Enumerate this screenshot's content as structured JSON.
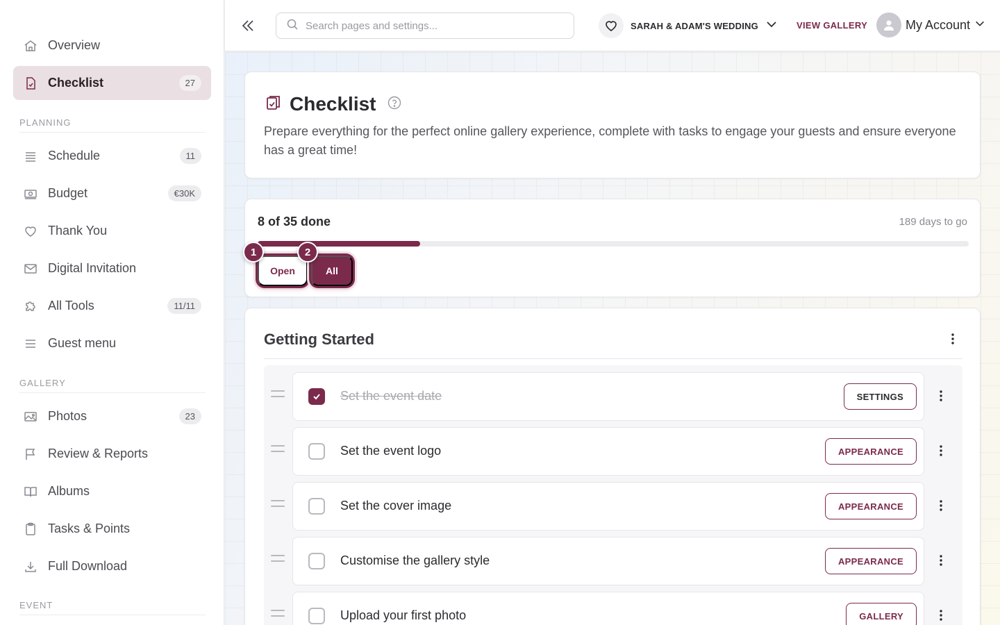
{
  "sidebar": {
    "items_top": [
      {
        "label": "Overview",
        "icon": "home-icon",
        "badge": ""
      },
      {
        "label": "Checklist",
        "icon": "checklist-icon",
        "badge": "27",
        "active": true
      }
    ],
    "planning_head": "PLANNING",
    "planning_items": [
      {
        "label": "Schedule",
        "icon": "schedule-icon",
        "badge": "11"
      },
      {
        "label": "Budget",
        "icon": "money-icon",
        "badge": "€30K"
      },
      {
        "label": "Thank You",
        "icon": "heart-icon",
        "badge": ""
      },
      {
        "label": "Digital Invitation",
        "icon": "envelope-icon",
        "badge": ""
      },
      {
        "label": "All Tools",
        "icon": "puzzle-icon",
        "badge": "11/11"
      },
      {
        "label": "Guest menu",
        "icon": "menu-icon",
        "badge": ""
      }
    ],
    "gallery_head": "GALLERY",
    "gallery_items": [
      {
        "label": "Photos",
        "icon": "image-icon",
        "badge": "23"
      },
      {
        "label": "Review & Reports",
        "icon": "flag-icon",
        "badge": ""
      },
      {
        "label": "Albums",
        "icon": "book-icon",
        "badge": ""
      },
      {
        "label": "Tasks & Points",
        "icon": "clipboard-icon",
        "badge": ""
      },
      {
        "label": "Full Download",
        "icon": "download-icon",
        "badge": ""
      }
    ],
    "event_head": "EVENT"
  },
  "topbar": {
    "search_placeholder": "Search pages and settings...",
    "event_name": "SARAH & ADAM'S WEDDING",
    "view_gallery": "VIEW GALLERY",
    "account_label": "My Account"
  },
  "header": {
    "title": "Checklist",
    "description": "Prepare everything for the perfect online gallery experience, complete with tasks to engage your guests and ensure everyone has a great time!"
  },
  "progress": {
    "done_label": "8 of 35 done",
    "days_label": "189 days to go",
    "fraction": 0.229,
    "filter_open": "Open",
    "filter_all": "All",
    "step_1": "1",
    "step_2": "2"
  },
  "group": {
    "title": "Getting Started",
    "tasks": [
      {
        "label": "Set the event date",
        "done": true,
        "action": "SETTINGS"
      },
      {
        "label": "Set the event logo",
        "done": false,
        "action": "APPEARANCE"
      },
      {
        "label": "Set the cover image",
        "done": false,
        "action": "APPEARANCE"
      },
      {
        "label": "Customise the gallery style",
        "done": false,
        "action": "APPEARANCE"
      },
      {
        "label": "Upload your first photo",
        "done": false,
        "action": "GALLERY"
      }
    ]
  },
  "colors": {
    "accent": "#7b2a4b",
    "active_bg": "#eadfe3"
  }
}
